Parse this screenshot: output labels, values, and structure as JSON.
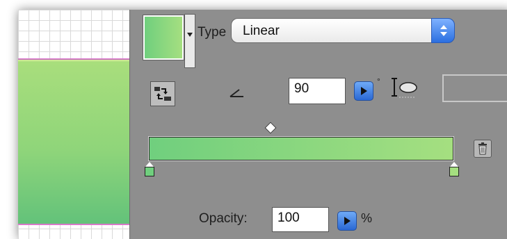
{
  "fill_panel": {
    "type_label": "Type",
    "type_value": "Linear",
    "angle_value": "90",
    "angle_unit": "°",
    "radius_unit_edge": "%",
    "opacity_label": "Opacity:",
    "opacity_value": "100",
    "opacity_unit": "%"
  },
  "gradient": {
    "stops": [
      {
        "position_percent": 0,
        "color": "#70cf7e"
      },
      {
        "position_percent": 100,
        "color": "#a5df80"
      }
    ],
    "midpoint_percent": 40
  },
  "colors": {
    "panel_bg": "#8e8e8e",
    "accent_blue": "#2a68d3",
    "guide_line": "#d778c9"
  },
  "icons": {
    "swap": "swap-colors-icon",
    "angle": "angle-icon",
    "radius": "radius-icon",
    "trash": "trash-icon"
  }
}
